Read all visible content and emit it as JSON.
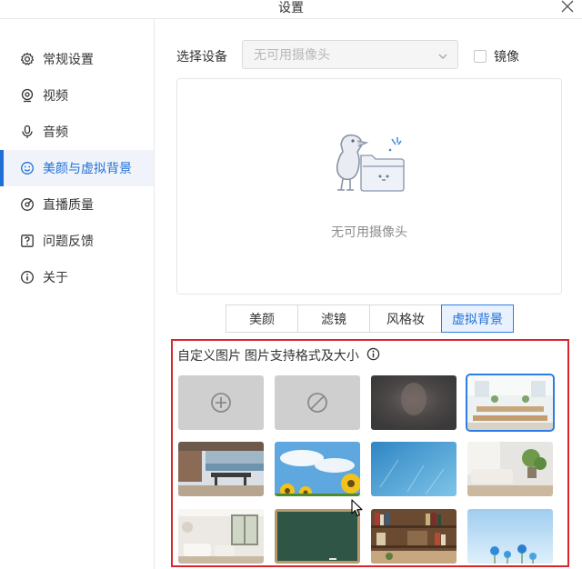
{
  "window": {
    "title": "设置"
  },
  "sidebar": {
    "items": [
      {
        "label": "常规设置",
        "icon": "gear-icon"
      },
      {
        "label": "视频",
        "icon": "camera-icon"
      },
      {
        "label": "音频",
        "icon": "microphone-icon"
      },
      {
        "label": "美颜与虚拟背景",
        "icon": "smiley-icon",
        "active": true
      },
      {
        "label": "直播质量",
        "icon": "quality-icon"
      },
      {
        "label": "问题反馈",
        "icon": "feedback-icon"
      },
      {
        "label": "关于",
        "icon": "info-icon"
      }
    ]
  },
  "device": {
    "label": "选择设备",
    "selected": "无可用摄像头",
    "mirror_label": "镜像",
    "mirror_checked": false
  },
  "preview": {
    "empty_message": "无可用摄像头"
  },
  "tabs": {
    "items": [
      {
        "label": "美颜"
      },
      {
        "label": "滤镜"
      },
      {
        "label": "风格妆"
      },
      {
        "label": "虚拟背景",
        "active": true
      }
    ]
  },
  "backgrounds": {
    "header": "自定义图片 图片支持格式及大小",
    "items": [
      {
        "name": "add-custom-image",
        "kind": "add-icon"
      },
      {
        "name": "no-background",
        "kind": "none-icon"
      },
      {
        "name": "blur-background",
        "kind": "blur"
      },
      {
        "name": "bright-office",
        "kind": "image",
        "selected": true
      },
      {
        "name": "dining-room-sea",
        "kind": "image"
      },
      {
        "name": "sunflower-sky",
        "kind": "image"
      },
      {
        "name": "blue-water",
        "kind": "image"
      },
      {
        "name": "living-room-plant",
        "kind": "image"
      },
      {
        "name": "bright-lounge",
        "kind": "image"
      },
      {
        "name": "chalkboard",
        "kind": "image"
      },
      {
        "name": "bookshelf",
        "kind": "image"
      },
      {
        "name": "blue-flowers",
        "kind": "image"
      }
    ]
  },
  "colors": {
    "accent": "#1f6fd6",
    "highlight_border": "#d9262c"
  }
}
